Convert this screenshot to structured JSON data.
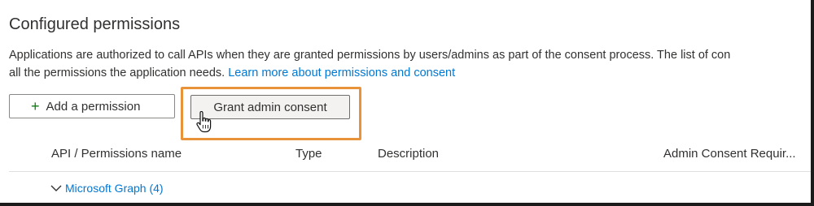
{
  "section": {
    "title": "Configured permissions",
    "description_line1": "Applications are authorized to call APIs when they are granted permissions by users/admins as part of the consent process. The list of con",
    "description_line2": "all the permissions the application needs.",
    "learn_more_link": "Learn more about permissions and consent"
  },
  "toolbar": {
    "add_permission_label": "Add a permission",
    "grant_consent_label": "Grant admin consent",
    "highlight_color": "#e8923a"
  },
  "table": {
    "columns": [
      "API / Permissions name",
      "Type",
      "Description",
      "Admin Consent Requir..."
    ],
    "groups": [
      {
        "label": "Microsoft Graph (4)",
        "expanded": true
      }
    ]
  },
  "colors": {
    "link": "#0078d4",
    "add_icon": "#107c10",
    "text": "#323130"
  }
}
